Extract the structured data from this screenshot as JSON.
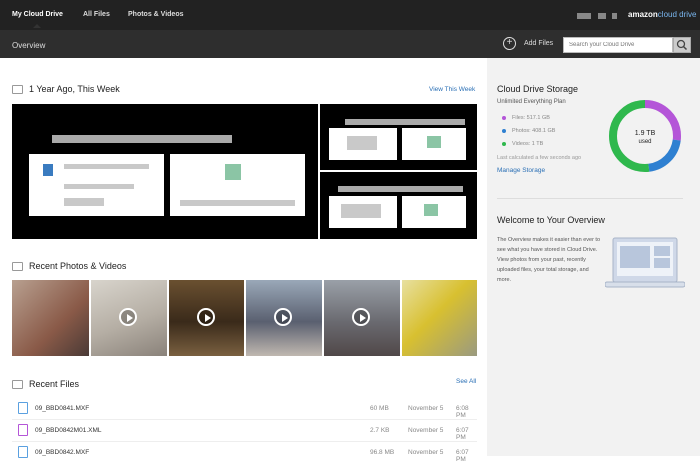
{
  "nav": {
    "tabs": [
      "My Cloud Drive",
      "All Files",
      "Photos & Videos"
    ],
    "logo_main": "amazon",
    "logo_sub": "cloud drive"
  },
  "subbar": {
    "title": "Overview",
    "add_label": "Add Files",
    "search_placeholder": "Search your Cloud Drive"
  },
  "year_ago": {
    "title": "1 Year Ago, This Week",
    "link": "View This Week"
  },
  "recent_photos": {
    "title": "Recent Photos & Videos"
  },
  "recent_files": {
    "title": "Recent Files",
    "link": "See All",
    "rows": [
      {
        "name": "09_BBD0841.MXF",
        "size": "60 MB",
        "date": "November 5",
        "time": "6:08 PM",
        "icon": "video-file-icon"
      },
      {
        "name": "09_BBD0842M01.XML",
        "size": "2.7 KB",
        "date": "November 5",
        "time": "6:07 PM",
        "icon": "code-file-icon"
      },
      {
        "name": "09_BBD0842.MXF",
        "size": "96.8 MB",
        "date": "November 5",
        "time": "6:07 PM",
        "icon": "video-file-icon"
      }
    ]
  },
  "storage": {
    "title": "Cloud Drive Storage",
    "plan": "Unlimited Everything Plan",
    "files": "Files: 517.1 GB",
    "photos": "Photos: 408.1 GB",
    "videos": "Videos: 1 TB",
    "last_calc": "Last calculated a few seconds ago",
    "manage": "Manage Storage",
    "donut_value": "1.9 TB",
    "donut_label": "used",
    "colors": {
      "files": "#b455d8",
      "photos": "#2f80d1",
      "videos": "#2fb84d"
    },
    "shares": {
      "files": 0.27,
      "photos": 0.21,
      "videos": 0.52
    }
  },
  "welcome": {
    "title": "Welcome to Your Overview",
    "body": "The Overview makes it easier than ever to see what you have stored in Cloud Drive. View photos from your past, recently uploaded files, your total storage, and more."
  }
}
